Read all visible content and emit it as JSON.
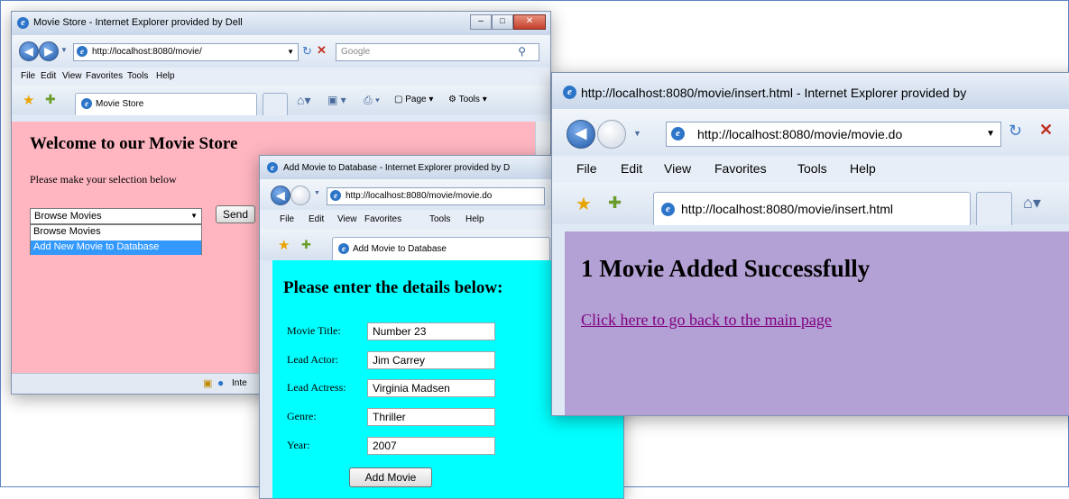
{
  "colors": {
    "win1_bg": "#ffb6c1",
    "win2_bg": "#00ffff",
    "win3_bg": "#b3a0d4",
    "link": "#800080",
    "select_highlight": "#3399ff"
  },
  "win1": {
    "title": "Movie Store - Internet Explorer provided by Dell",
    "address": "http://localhost:8080/movie/",
    "search_placeholder": "Google",
    "menu": [
      "File",
      "Edit",
      "View",
      "Favorites",
      "Tools",
      "Help"
    ],
    "tab_label": "Movie Store",
    "toolbar": {
      "page": "Page",
      "tools": "Tools"
    },
    "heading": "Welcome to our Movie Store",
    "subtext": "Please make your selection below",
    "select_value": "Browse Movies",
    "options": [
      "Browse Movies",
      "Add New Movie to Database"
    ],
    "send_label": "Send",
    "status_text": "Inte"
  },
  "win2": {
    "title": "Add Movie to Database - Internet Explorer provided by D",
    "address": "http://localhost:8080/movie/movie.do",
    "menu": [
      "File",
      "Edit",
      "View",
      "Favorites",
      "Tools",
      "Help"
    ],
    "tab_label": "Add Movie to Database",
    "heading": "Please enter the details below:",
    "fields": [
      {
        "label": "Movie Title:",
        "value": "Number 23"
      },
      {
        "label": "Lead Actor:",
        "value": "Jim Carrey"
      },
      {
        "label": "Lead Actress:",
        "value": "Virginia Madsen"
      },
      {
        "label": "Genre:",
        "value": "Thriller"
      },
      {
        "label": "Year:",
        "value": "2007"
      }
    ],
    "submit_label": "Add Movie"
  },
  "win3": {
    "title": "http://localhost:8080/movie/insert.html - Internet Explorer provided by",
    "address": "http://localhost:8080/movie/movie.do",
    "menu": [
      "File",
      "Edit",
      "View",
      "Favorites",
      "Tools",
      "Help"
    ],
    "tab_label": "http://localhost:8080/movie/insert.html",
    "heading": "1 Movie Added Successfully",
    "link_text": "Click here to go back to the main page"
  }
}
